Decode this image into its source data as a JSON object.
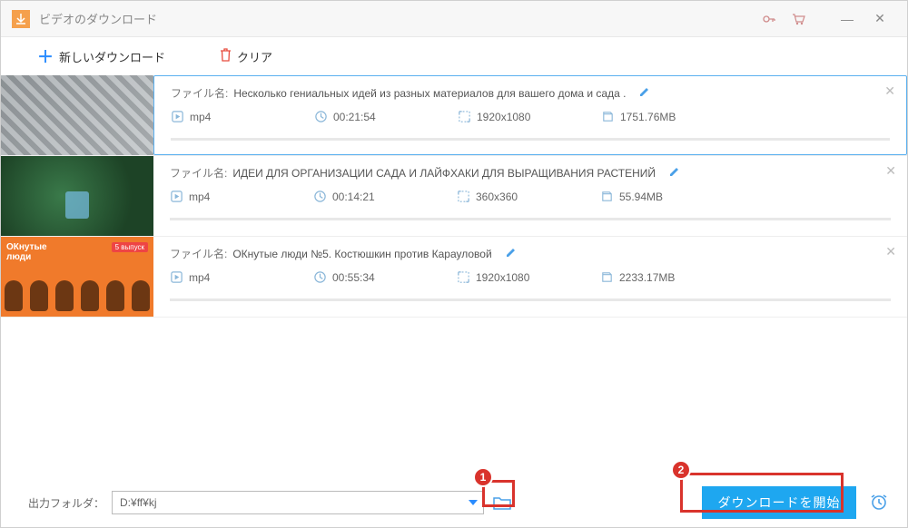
{
  "window": {
    "title": "ビデオのダウンロード"
  },
  "toolbar": {
    "new_download": "新しいダウンロード",
    "clear": "クリア"
  },
  "file_label": "ファイル名:",
  "items": [
    {
      "name": "Несколько гениальных идей из разных материалов для вашего дома и сада .",
      "format": "mp4",
      "duration": "00:21:54",
      "resolution": "1920x1080",
      "size": "1751.76MB",
      "selected": true
    },
    {
      "name": "ИДЕИ ДЛЯ ОРГАНИЗАЦИИ САДА И ЛАЙФХАКИ ДЛЯ ВЫРАЩИВАНИЯ РАСТЕНИЙ",
      "format": "mp4",
      "duration": "00:14:21",
      "resolution": "360x360",
      "size": "55.94MB",
      "selected": false
    },
    {
      "name": "ОКнутые люди №5. Костюшкин против Карауловой",
      "format": "mp4",
      "duration": "00:55:34",
      "resolution": "1920x1080",
      "size": "2233.17MB",
      "selected": false
    }
  ],
  "thumb3_overlay": {
    "title_line1": "ОКнутые",
    "title_line2": "люди",
    "badge": "5 выпуск"
  },
  "footer": {
    "out_label": "出力フォルダ：",
    "out_path": "D:¥ff¥kj",
    "start_label": "ダウンロードを開始"
  },
  "callouts": {
    "one": "1",
    "two": "2"
  }
}
